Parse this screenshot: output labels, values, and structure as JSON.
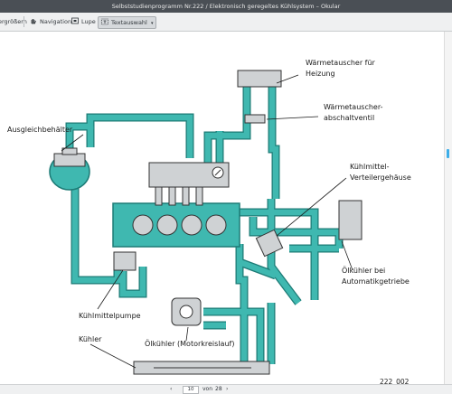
{
  "window": {
    "title": "Selbststudienprogramm Nr.222 / Elektronisch geregeltes Kühlsystem – Okular"
  },
  "toolbar": {
    "zoom_label": "Vergrößern",
    "navigation_label": "Navigation",
    "magnifier_label": "Lupe",
    "text_selection_label": "Textauswahl"
  },
  "diagram": {
    "labels": {
      "expansion_tank": "Ausgleichbehälter",
      "heat_exchanger_line1": "Wärmetauscher für",
      "heat_exchanger_line2": "Heizung",
      "shutoff_valve_line1": "Wärmetauscher-",
      "shutoff_valve_line2": "abschaltventil",
      "distributor_line1": "Kühlmittel-",
      "distributor_line2": "Verteilergehäuse",
      "coolant_pump": "Kühlmittelpumpe",
      "atf_cooler_line1": "Ölkühler bei",
      "atf_cooler_line2": "Automatikgetriebe",
      "radiator": "Kühler",
      "oil_cooler": "Ölkühler (Motorkreislauf)",
      "figure_number": "222_002"
    },
    "colors": {
      "coolant": "#3fb8b0",
      "coolant_dark": "#1d7b76",
      "engine_fill": "#3fb8b0",
      "component_gray": "#cfd2d4"
    }
  },
  "statusbar": {
    "current_page": "10",
    "of_label": "von",
    "total_pages": "28"
  }
}
